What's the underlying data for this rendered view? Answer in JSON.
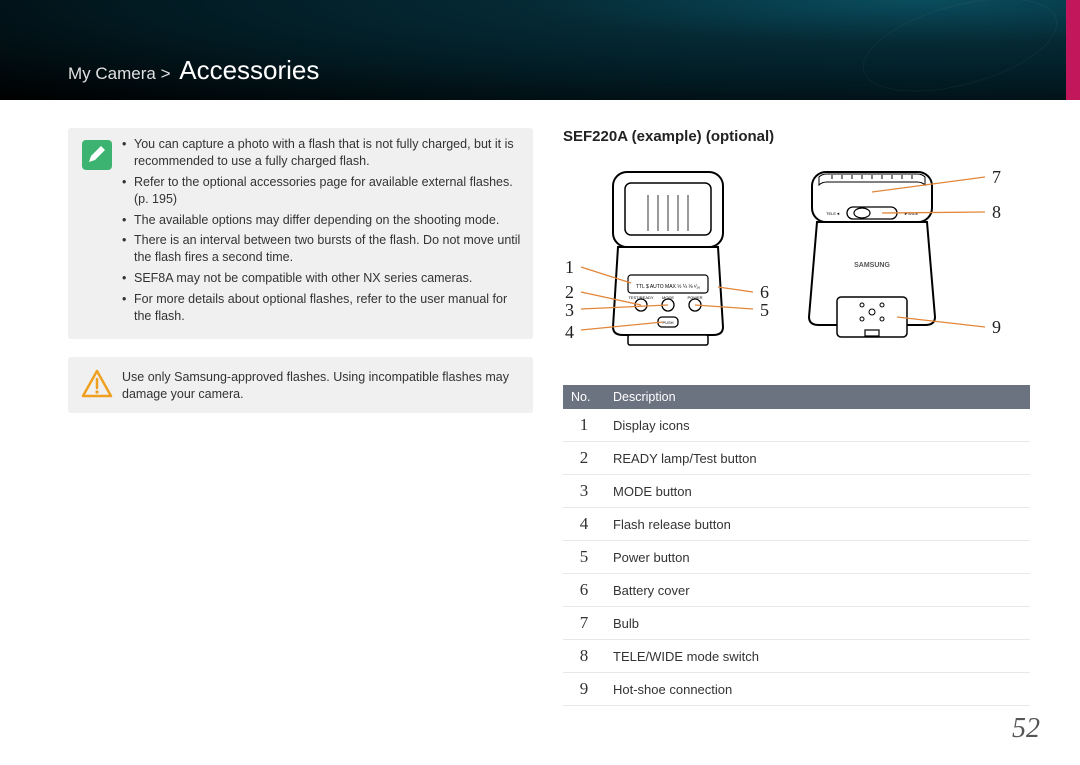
{
  "breadcrumb": {
    "path": "My Camera >",
    "title": "Accessories"
  },
  "info_notes": [
    "You can capture a photo with a flash that is not fully charged, but it is recommended to use a fully charged flash.",
    "Refer to the optional accessories page for available external flashes. (p. 195)",
    "The available options may differ depending on the shooting mode.",
    "There is an interval between two bursts of the flash. Do not move until the flash fires a second time.",
    "SEF8A may not be compatible with other NX series cameras.",
    "For more details about optional flashes, refer to the user manual for the flash."
  ],
  "warning_text": "Use only Samsung-approved flashes. Using incompatible flashes may damage your camera.",
  "section_title": "SEF220A (example) (optional)",
  "callouts_left": {
    "c1": "1",
    "c2": "2",
    "c3": "3",
    "c4": "4",
    "c5": "5",
    "c6": "6"
  },
  "callouts_right": {
    "c7": "7",
    "c8": "8",
    "c9": "9"
  },
  "table": {
    "header_no": "No.",
    "header_desc": "Description",
    "rows": [
      {
        "no": "1",
        "desc": "Display icons"
      },
      {
        "no": "2",
        "desc": "READY lamp/Test button"
      },
      {
        "no": "3",
        "desc": "MODE button"
      },
      {
        "no": "4",
        "desc": "Flash release button"
      },
      {
        "no": "5",
        "desc": "Power button"
      },
      {
        "no": "6",
        "desc": "Battery cover"
      },
      {
        "no": "7",
        "desc": "Bulb"
      },
      {
        "no": "8",
        "desc": "TELE/WIDE mode switch"
      },
      {
        "no": "9",
        "desc": "Hot-shoe connection"
      }
    ]
  },
  "page_number": "52"
}
